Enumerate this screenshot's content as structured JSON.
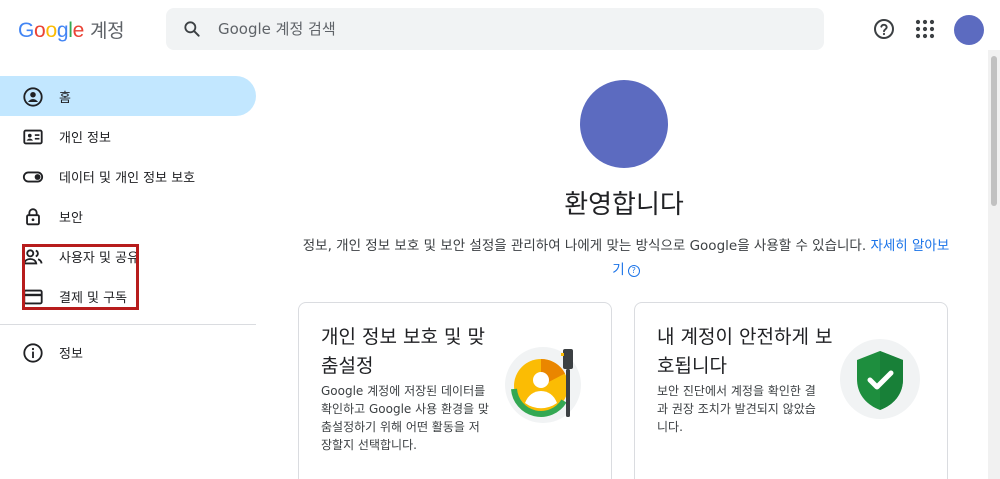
{
  "header": {
    "logo_letters": [
      "G",
      "o",
      "o",
      "g",
      "l",
      "e"
    ],
    "logo_suffix": "계정",
    "search_placeholder": "Google 계정 검색",
    "icons": [
      "search-icon",
      "help-icon",
      "apps-icon"
    ]
  },
  "sidebar": {
    "items": [
      {
        "label": "홈",
        "icon": "home-icon",
        "active": true
      },
      {
        "label": "개인 정보",
        "icon": "id-card-icon"
      },
      {
        "label": "데이터 및 개인 정보 보호",
        "icon": "toggle-icon"
      },
      {
        "label": "보안",
        "icon": "lock-icon"
      },
      {
        "label": "사용자 및 공유",
        "icon": "people-icon"
      },
      {
        "label": "결제 및 구독",
        "icon": "credit-card-icon"
      }
    ],
    "info_item": {
      "label": "정보",
      "icon": "info-icon"
    }
  },
  "main": {
    "welcome": "환영합니다",
    "description": "정보, 개인 정보 보호 및 보안 설정을 관리하여 나에게 맞는 방식으로 Google을 사용할 수 있습니다.",
    "learn_more": "자세히 알아보기",
    "cards": [
      {
        "title": "개인 정보 보호 및 맞춤설정",
        "description": "Google 계정에 저장된 데이터를 확인하고 Google 사용 환경을 맞춤설정하기 위해 어떤 활동을 저장할지 선택합니다."
      },
      {
        "title": "내 계정이 안전하게 보호됩니다",
        "description": "보안 진단에서 계정을 확인한 결과 권장 조치가 발견되지 않았습니다."
      }
    ]
  },
  "colors": {
    "accent": "#1a73e8",
    "active_nav": "#c2e7ff",
    "avatar": "#5c6bc0",
    "highlight_box": "#b71c1c",
    "shield": "#1e8e3e"
  }
}
